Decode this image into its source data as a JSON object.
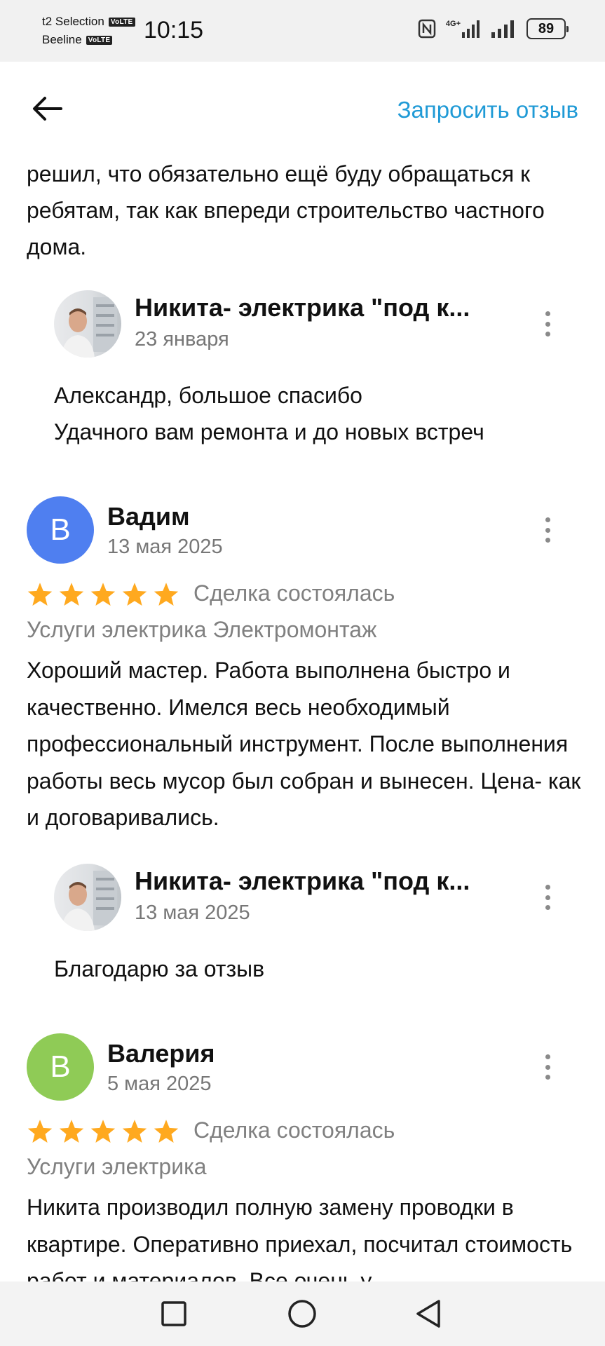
{
  "status_bar": {
    "carrier1": "t2 Selection",
    "carrier2": "Beeline",
    "volte": "VoLTE",
    "time": "10:15",
    "network": "4G+",
    "battery": "89"
  },
  "header": {
    "request_review": "Запросить отзыв"
  },
  "previous_review": {
    "text_tail": "решил, что обязательно ещё буду обращаться к ребятам, так как впереди строительство частного дома.",
    "reply": {
      "author": "Никита- электрика \"под к...",
      "date": "23 января",
      "line1": "Александр, большое спасибо",
      "line2": "Удачного вам ремонта и до новых встреч"
    }
  },
  "reviews": [
    {
      "initial": "В",
      "avatar_color": "#4f7ff0",
      "author": "Вадим",
      "date": "13 мая 2025",
      "rating": 5,
      "deal_status": "Сделка состоялась",
      "category": "Услуги электрика Электромонтаж",
      "text": "Хороший мастер. Работа выполнена быстро и качественно.  Имелся весь необходимый профессиональный инструмент. После выполнения работы весь мусор был собран и вынесен. Цена- как и договаривались.",
      "reply": {
        "author": "Никита- электрика \"под к...",
        "date": "13 мая 2025",
        "text": "Благодарю за отзыв"
      }
    },
    {
      "initial": "В",
      "avatar_color": "#8fcb56",
      "author": "Валерия",
      "date": "5 мая 2025",
      "rating": 5,
      "deal_status": "Сделка состоялась",
      "category": "Услуги электрика",
      "text": "Никита производил полную замену проводки в квартире. Оперативно приехал, посчитал стоимость работ и материалов. Все очень у"
    }
  ],
  "colors": {
    "star": "#ffa91f",
    "link": "#1f9ad6"
  }
}
